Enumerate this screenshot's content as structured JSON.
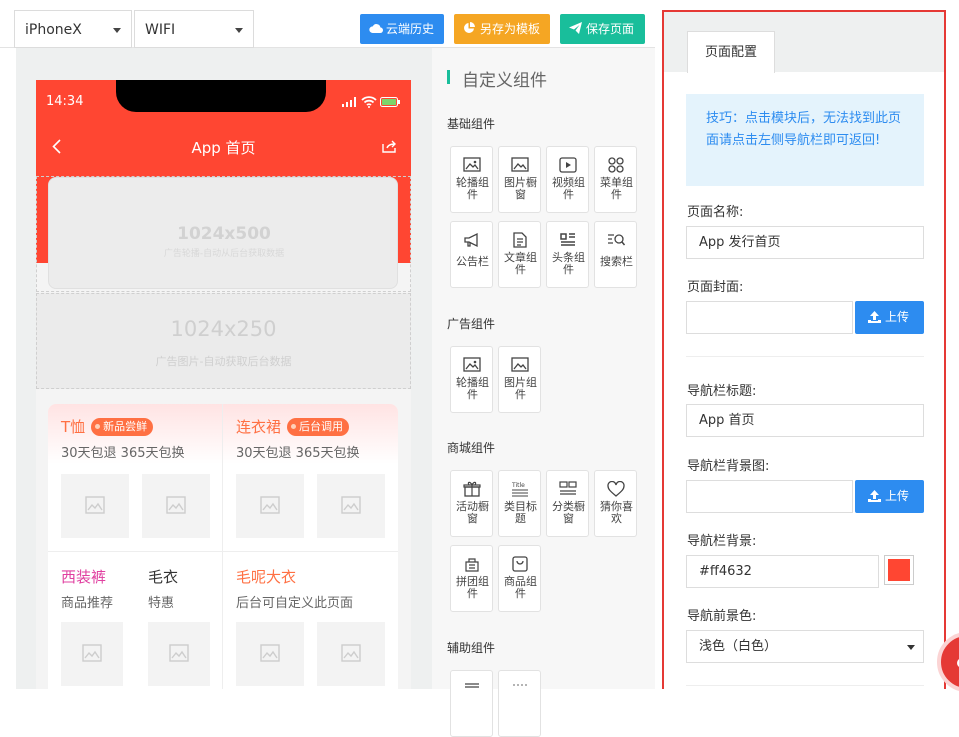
{
  "toolbar": {
    "device": "iPhoneX",
    "network": "WIFI",
    "cloud_history": "云端历史",
    "save_as_template": "另存为模板",
    "save_page": "保存页面",
    "colors": {
      "blue": "#2d8cf0",
      "orange": "#f5a623",
      "green": "#19be9b"
    }
  },
  "phone": {
    "time": "14:34",
    "nav_title": "App 首页",
    "accent": "#ff4632",
    "banner": {
      "size": "1024x500",
      "caption": "广告轮播-自动从后台获取数据"
    },
    "ad": {
      "size": "1024x250",
      "caption": "广告图片-自动获取后台数据"
    },
    "products": [
      {
        "title": "T恤",
        "tag": "新品尝鲜",
        "subtitle": "30天包退 365天包换",
        "title_color": "#ff7043"
      },
      {
        "title": "连衣裙",
        "tag": "后台调用",
        "subtitle": "30天包退 365天包换",
        "title_color": "#ff7043"
      },
      {
        "title": "西装裤",
        "subtitle": "商品推荐",
        "title_color": "#e040a0"
      },
      {
        "title": "毛衣",
        "subtitle": "特惠",
        "title_color": "#333333"
      },
      {
        "title": "毛呢大衣",
        "subtitle": "后台可自定义此页面",
        "title_color": "#ff7043"
      }
    ]
  },
  "components": {
    "header": "自定义组件",
    "groups": [
      {
        "title": "基础组件",
        "items": [
          {
            "label": "轮播组件",
            "icon": "carousel-icon"
          },
          {
            "label": "图片橱窗",
            "icon": "image-icon"
          },
          {
            "label": "视频组件",
            "icon": "video-icon"
          },
          {
            "label": "菜单组件",
            "icon": "menu-grid-icon"
          },
          {
            "label": "公告栏",
            "icon": "megaphone-icon"
          },
          {
            "label": "文章组件",
            "icon": "article-icon"
          },
          {
            "label": "头条组件",
            "icon": "headline-icon"
          },
          {
            "label": "搜索栏",
            "icon": "search-list-icon"
          }
        ]
      },
      {
        "title": "广告组件",
        "items": [
          {
            "label": "轮播组件",
            "icon": "carousel-icon"
          },
          {
            "label": "图片组件",
            "icon": "image-icon"
          }
        ]
      },
      {
        "title": "商城组件",
        "items": [
          {
            "label": "活动橱窗",
            "icon": "gift-icon"
          },
          {
            "label": "类目标题",
            "icon": "title-icon"
          },
          {
            "label": "分类橱窗",
            "icon": "category-icon"
          },
          {
            "label": "猜你喜欢",
            "icon": "heart-icon"
          },
          {
            "label": "拼团组件",
            "icon": "group-buy-icon"
          },
          {
            "label": "商品组件",
            "icon": "product-icon"
          }
        ]
      },
      {
        "title": "辅助组件",
        "items": []
      }
    ]
  },
  "config": {
    "tab": "页面配置",
    "tip": "技巧：点击模块后，无法找到此页面请点击左侧导航栏即可返回!",
    "page_name_label": "页面名称:",
    "page_name_value": "App 发行首页",
    "cover_label": "页面封面:",
    "upload_label": "上传",
    "nav_title_label": "导航栏标题:",
    "nav_title_value": "App 首页",
    "nav_bg_image_label": "导航栏背景图:",
    "nav_bg_label": "导航栏背景:",
    "nav_bg_value": "#ff4632",
    "nav_fg_label": "导航前景色:",
    "nav_fg_value": "浅色（白色）"
  }
}
